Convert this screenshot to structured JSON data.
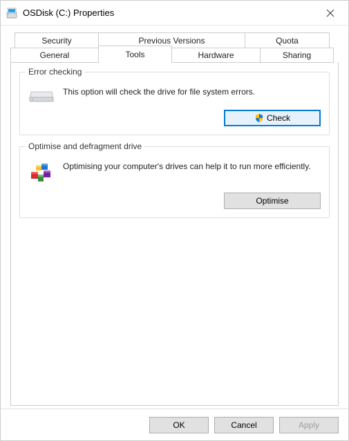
{
  "title": "OSDisk (C:) Properties",
  "tabs": {
    "row1": [
      "Security",
      "Previous Versions",
      "Quota"
    ],
    "row2": [
      "General",
      "Tools",
      "Hardware",
      "Sharing"
    ],
    "active": "Tools"
  },
  "groups": {
    "error_checking": {
      "title": "Error checking",
      "text": "This option will check the drive for file system errors.",
      "button": "Check"
    },
    "optimise": {
      "title": "Optimise and defragment drive",
      "text": "Optimising your computer's drives can help it to run more efficiently.",
      "button": "Optimise"
    }
  },
  "footer": {
    "ok": "OK",
    "cancel": "Cancel",
    "apply": "Apply"
  }
}
